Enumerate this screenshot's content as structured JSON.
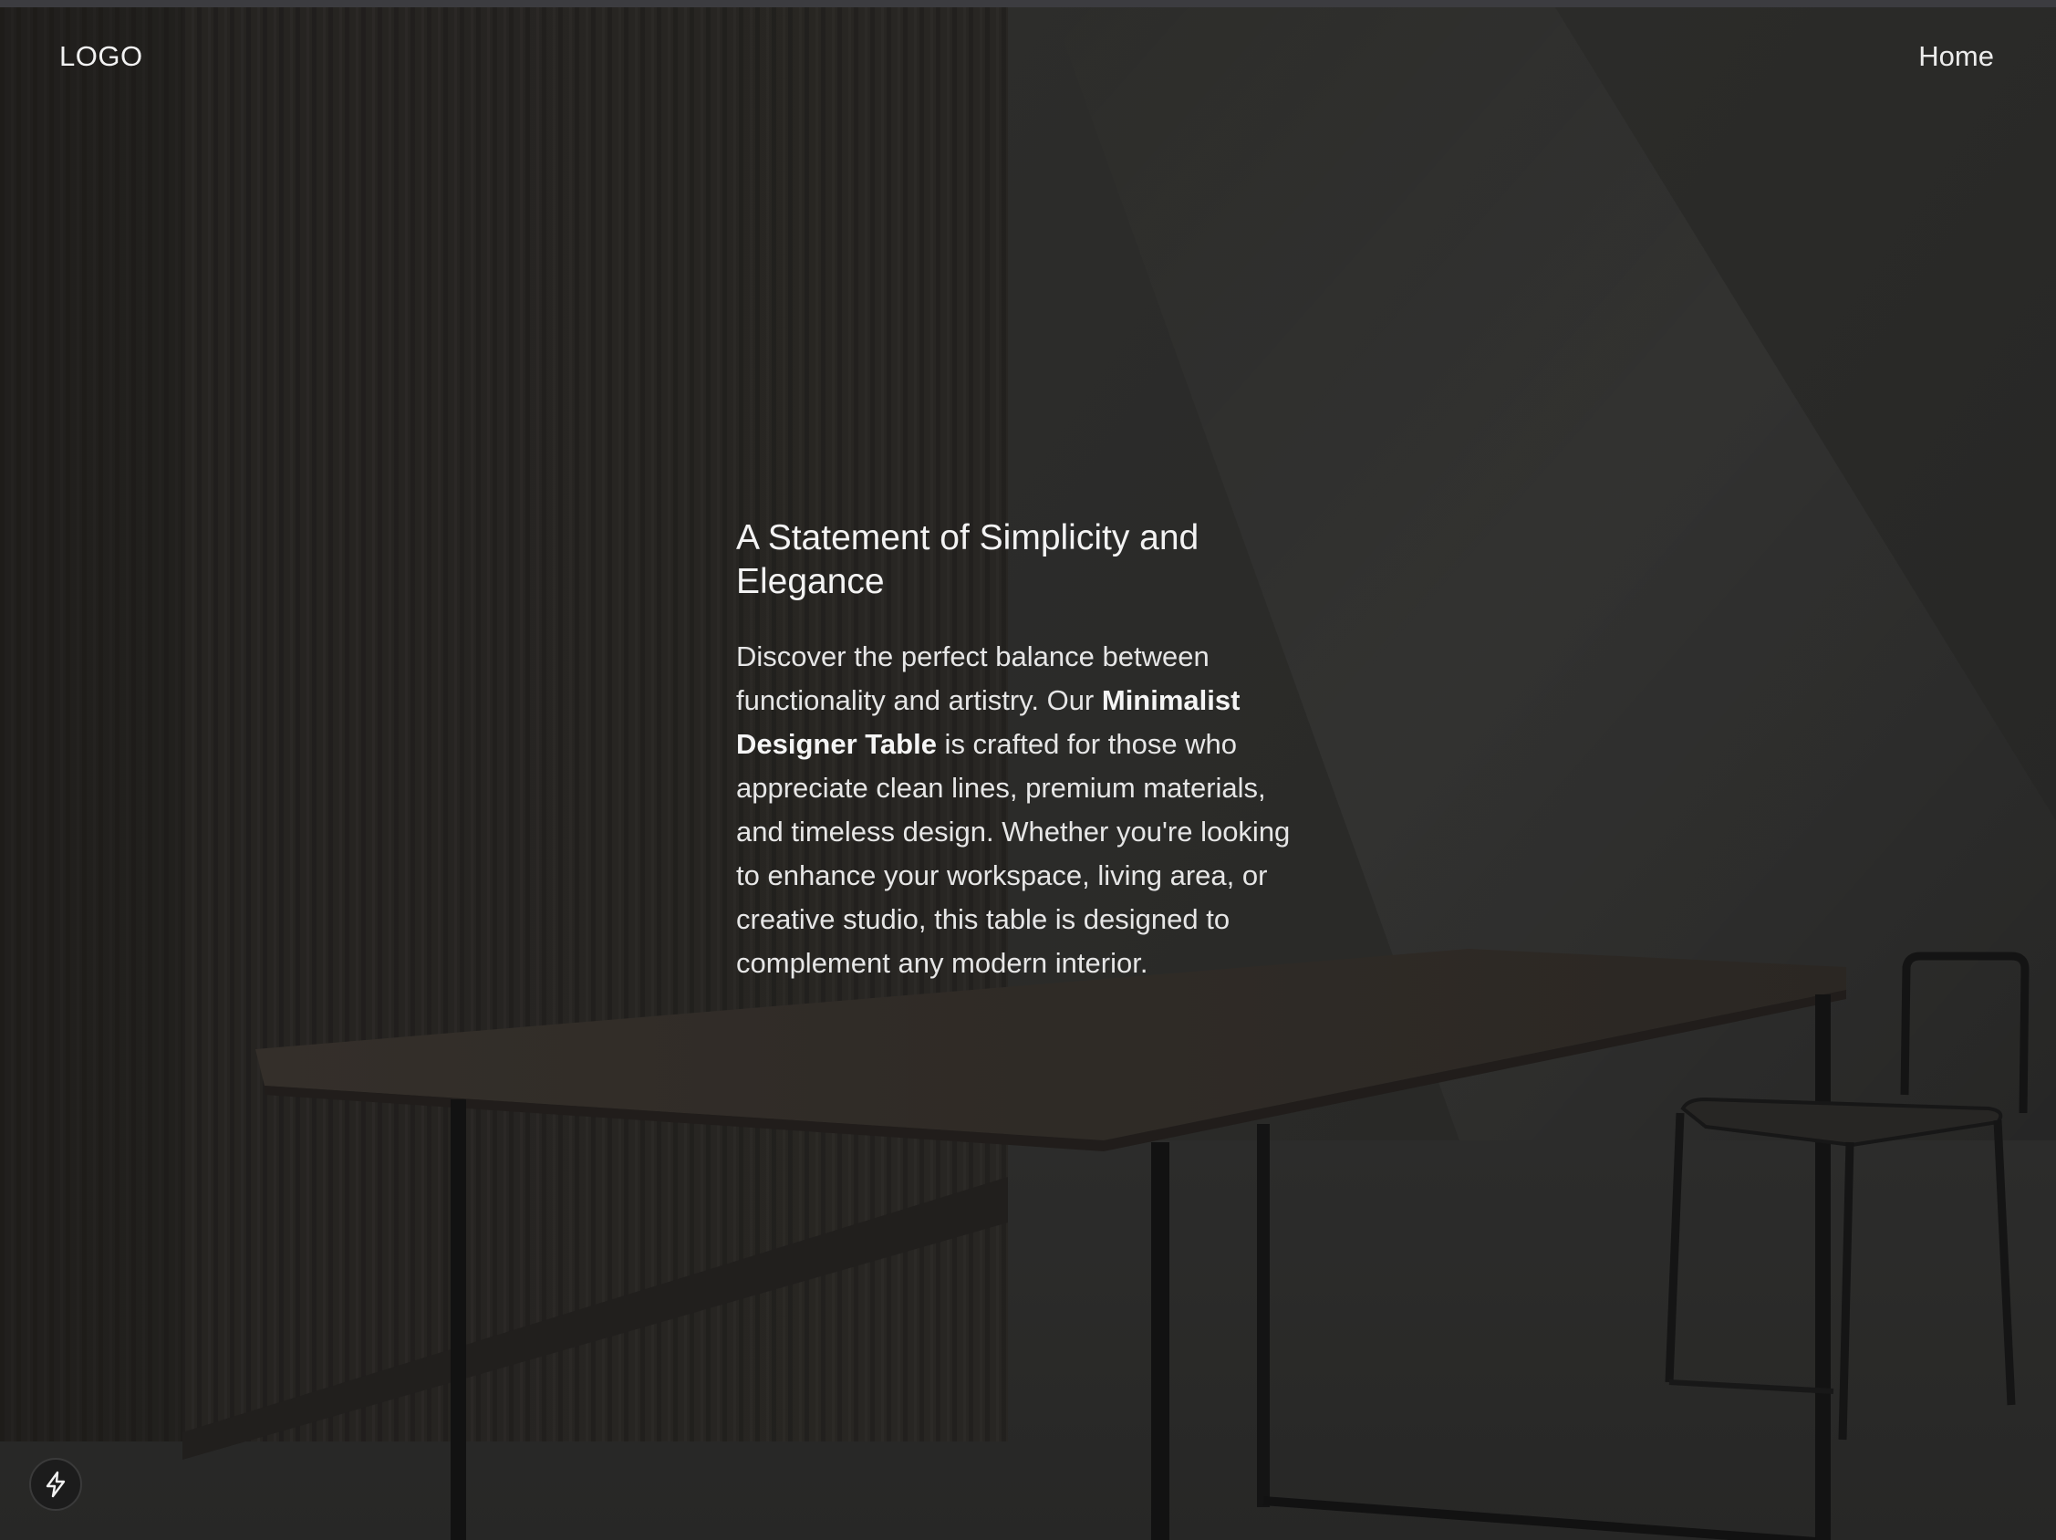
{
  "header": {
    "logo_text": "LOGO",
    "nav": {
      "home_label": "Home"
    }
  },
  "hero": {
    "headline": "A Statement of Simplicity and Elegance",
    "body_prefix": "Discover the perfect balance between functionality and artistry. Our ",
    "body_bold": "Minimalist Designer Table",
    "body_suffix": " is crafted for those who appreciate clean lines, premium materials, and timeless design. Whether you're looking to enhance your workspace, living area, or creative studio, this table is designed to complement any modern interior."
  },
  "badge": {
    "icon": "lightning-bolt-icon"
  },
  "colors": {
    "background": "#2e2e2c",
    "text": "#f1f1f1",
    "table_top": "#3a342e",
    "frame": "#151515"
  }
}
